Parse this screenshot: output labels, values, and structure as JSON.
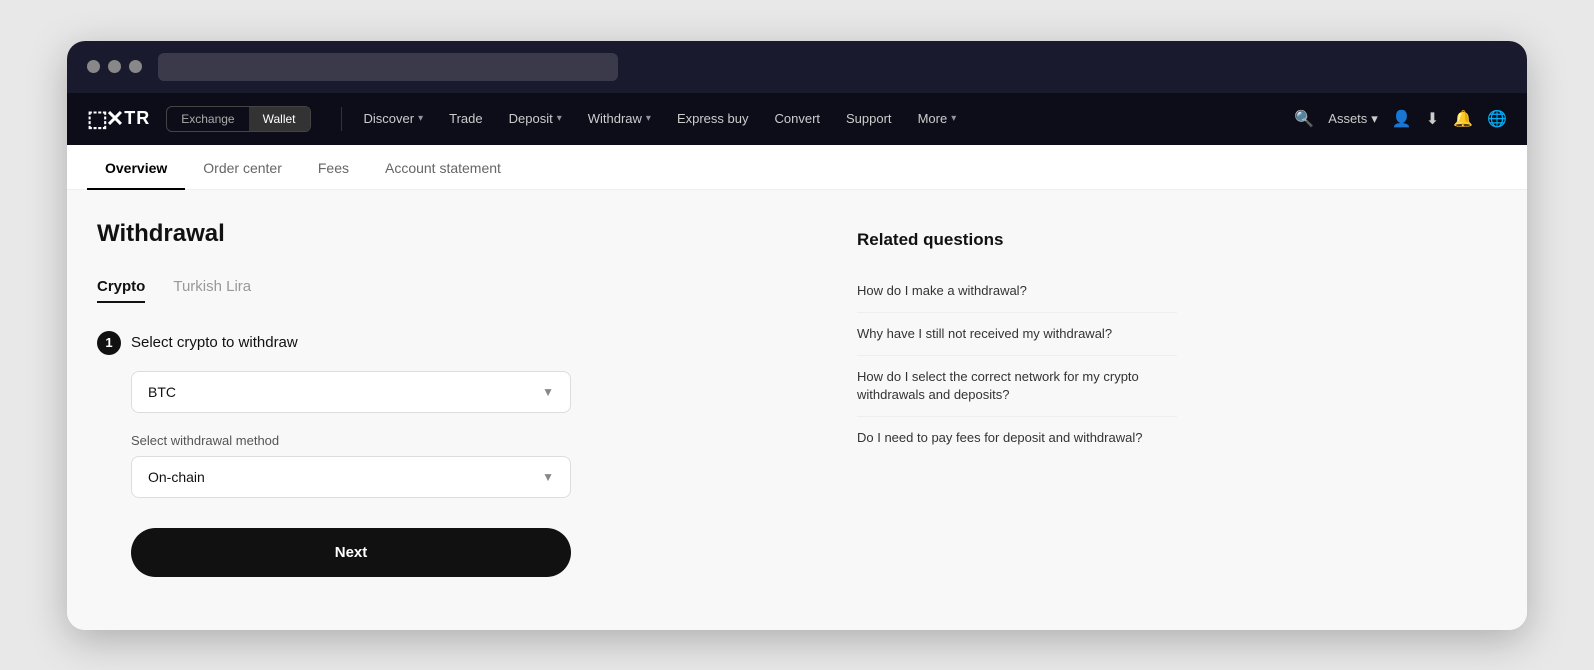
{
  "browser": {
    "address_bar_placeholder": ""
  },
  "navbar": {
    "logo_icon": "⬚×",
    "logo_text": "TR",
    "exchange_label": "Exchange",
    "wallet_label": "Wallet",
    "nav_items": [
      {
        "label": "Discover",
        "has_chevron": true
      },
      {
        "label": "Trade",
        "has_chevron": false
      },
      {
        "label": "Deposit",
        "has_chevron": true
      },
      {
        "label": "Withdraw",
        "has_chevron": true
      },
      {
        "label": "Express buy",
        "has_chevron": false
      },
      {
        "label": "Convert",
        "has_chevron": false
      },
      {
        "label": "Support",
        "has_chevron": false
      },
      {
        "label": "More",
        "has_chevron": true
      }
    ],
    "assets_label": "Assets",
    "search_icon": "🔍",
    "user_icon": "👤",
    "download_icon": "⬇",
    "bell_icon": "🔔",
    "globe_icon": "🌐"
  },
  "sub_nav": {
    "items": [
      {
        "label": "Overview",
        "active": true
      },
      {
        "label": "Order center",
        "active": false
      },
      {
        "label": "Fees",
        "active": false
      },
      {
        "label": "Account statement",
        "active": false
      }
    ]
  },
  "page": {
    "title": "Withdrawal",
    "tabs": [
      {
        "label": "Crypto",
        "active": true
      },
      {
        "label": "Turkish Lira",
        "active": false
      }
    ],
    "step1_label": "Select crypto to withdraw",
    "step1_number": "1",
    "crypto_dropdown": {
      "value": "BTC",
      "chevron": "▼"
    },
    "method_label": "Select withdrawal method",
    "method_dropdown": {
      "value": "On-chain",
      "chevron": "▼"
    },
    "next_button": "Next"
  },
  "related": {
    "title": "Related questions",
    "faqs": [
      {
        "text": "How do I make a withdrawal?"
      },
      {
        "text": "Why have I still not received my withdrawal?"
      },
      {
        "text": "How do I select the correct network for my crypto withdrawals and deposits?"
      },
      {
        "text": "Do I need to pay fees for deposit and withdrawal?"
      }
    ]
  }
}
